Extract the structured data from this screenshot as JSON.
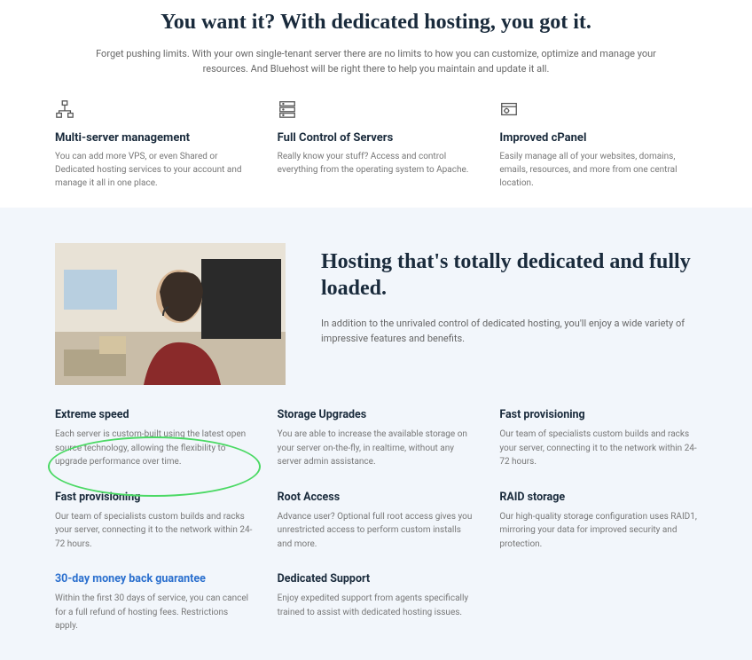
{
  "hero": {
    "title": "You want it? With dedicated hosting, you got it.",
    "subtitle": "Forget pushing limits. With your own single-tenant server there are no limits to how you can customize, optimize and manage your resources. And Bluehost will be right there to help you maintain and update it all."
  },
  "topFeatures": [
    {
      "title": "Multi-server management",
      "desc": "You can add more VPS, or even Shared or Dedicated hosting services to your account and manage it all in one place."
    },
    {
      "title": "Full Control of Servers",
      "desc": "Really know your stuff? Access and control everything from the operating system to Apache."
    },
    {
      "title": "Improved cPanel",
      "desc": "Easily manage all of your websites, domains, emails, resources, and more from one central location."
    }
  ],
  "section2": {
    "title": "Hosting that's totally dedicated and fully loaded.",
    "subtitle": "In addition to the unrivaled control of dedicated hosting, you'll enjoy a wide variety of impressive features and benefits."
  },
  "features": [
    {
      "title": "Extreme speed",
      "desc": "Each server is custom-built using the latest open source technology, allowing the flexibility to upgrade performance over time."
    },
    {
      "title": "Storage Upgrades",
      "desc": "You are able to increase the available storage on your server on-the-fly, in realtime, without any server admin assistance."
    },
    {
      "title": "Fast provisioning",
      "desc": "Our team of specialists custom builds and racks your server, connecting it to the network within 24-72 hours."
    },
    {
      "title": "Fast provisioning",
      "desc": "Our team of specialists custom builds and racks your server, connecting it to the network within 24-72 hours."
    },
    {
      "title": "Root Access",
      "desc": "Advance user? Optional full root access gives you unrestricted access to perform custom installs and more."
    },
    {
      "title": "RAID storage",
      "desc": "Our high-quality storage configuration uses RAID1, mirroring your data for improved security and protection."
    },
    {
      "title": "30-day money back guarantee",
      "desc": "Within the first 30 days of service, you can cancel for a full refund of hosting fees. Restrictions apply.",
      "link": true
    },
    {
      "title": "Dedicated Support",
      "desc": "Enjoy expedited support from agents specifically trained to assist with dedicated hosting issues."
    }
  ]
}
